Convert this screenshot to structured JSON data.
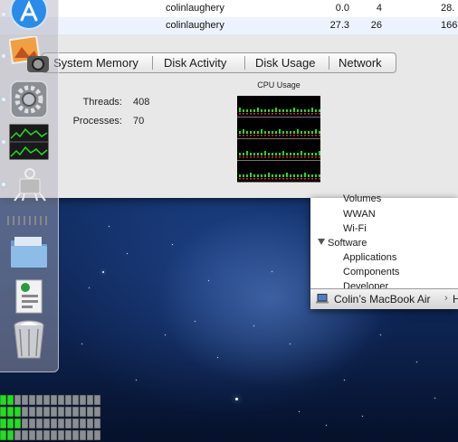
{
  "process_table": {
    "rows": [
      {
        "user": "colinlaughery",
        "cpu": "0.0",
        "threads": "4",
        "real_mem": "28."
      },
      {
        "user": "colinlaughery",
        "cpu": "27.3",
        "threads": "26",
        "real_mem": "166."
      }
    ]
  },
  "tabs": [
    {
      "label": "System Memory"
    },
    {
      "label": "Disk Activity"
    },
    {
      "label": "Disk Usage"
    },
    {
      "label": "Network"
    }
  ],
  "cpu_panel": {
    "threads_label": "Threads:",
    "threads_value": "408",
    "processes_label": "Processes:",
    "processes_value": "70",
    "graph_title": "CPU Usage"
  },
  "sidebar": {
    "items": [
      {
        "label": "Volumes"
      },
      {
        "label": "WWAN"
      },
      {
        "label": "Wi-Fi"
      },
      {
        "label": "Software"
      },
      {
        "label": "Applications"
      },
      {
        "label": "Components"
      },
      {
        "label": "Developer"
      }
    ],
    "footer_computer": "Colin’s MacBook Air",
    "footer_extra": "H"
  },
  "dock": {
    "icons": [
      "app-store-icon",
      "iphoto-icon",
      "system-preferences-icon",
      "activity-monitor-icon",
      "system-information-icon",
      "downloads-stack-icon",
      "applications-folder-icon",
      "documents-stack-icon",
      "trash-icon"
    ]
  },
  "colors": {
    "cpu_green": "#22dd22",
    "cpu_red": "#ee2222",
    "desktop_blue": "#123068"
  }
}
